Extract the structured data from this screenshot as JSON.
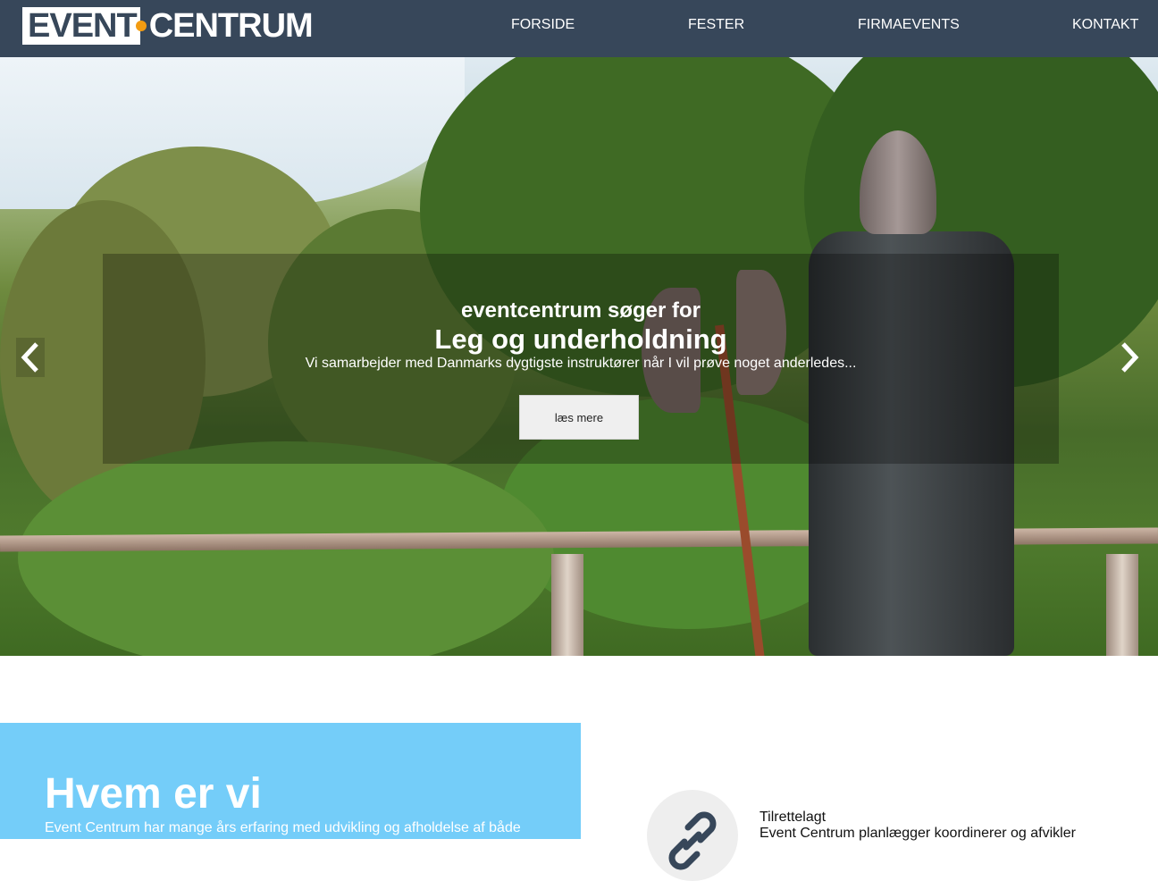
{
  "navbar": {
    "logo": {
      "left": "EVENT",
      "right": "CENTRUM",
      "dot_color": "#f39c12"
    },
    "items": [
      {
        "label": "FORSIDE"
      },
      {
        "label": "FESTER"
      },
      {
        "label": "FIRMAEVENTS"
      },
      {
        "label": "KONTAKT"
      }
    ],
    "background": "#37475a"
  },
  "hero": {
    "kicker": "eventcentrum søger for",
    "title": "Leg og underholdning",
    "text": "Vi samarbejder med Danmarks dygtigste instruktører når I vil prøve noget anderledes...",
    "button_label": "læs mere",
    "prev_icon": "chevron-left-icon",
    "next_icon": "chevron-right-icon"
  },
  "about": {
    "title": "Hvem er vi",
    "text": "Event Centrum har mange års erfaring med udvikling og afholdelse af både",
    "background": "#74cdf9"
  },
  "service": {
    "icon": "link-icon",
    "title": "Tilrettelagt",
    "text": "Event Centrum planlægger koordinerer og afvikler"
  }
}
